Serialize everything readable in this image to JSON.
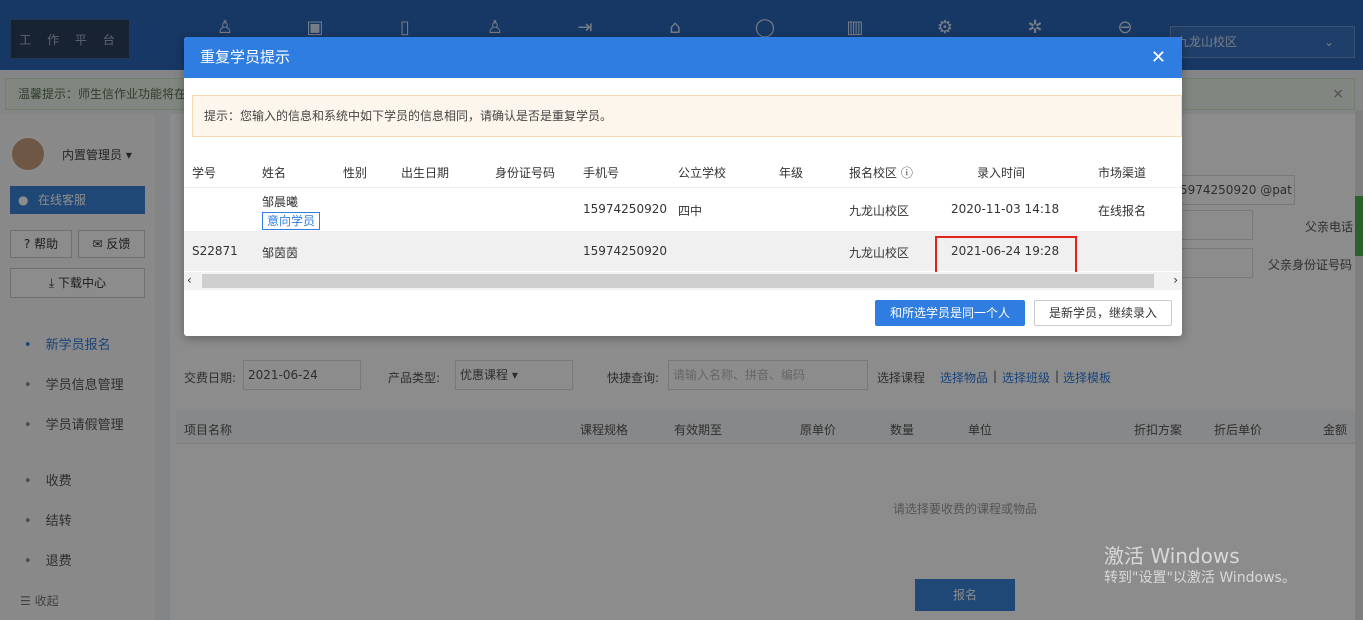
{
  "topbar": {
    "logo_text": "工 作 平 台",
    "nav_icons": [
      "user-add-icon",
      "card-icon",
      "book-icon",
      "person-icon",
      "login-icon",
      "home-icon",
      "refresh-icon",
      "chart-icon",
      "gear-icon",
      "tool-icon",
      "more-icon"
    ],
    "campus": "九龙山校区"
  },
  "notice": {
    "text": "温馨提示：师生信作业功能将在"
  },
  "sidebar": {
    "admin_name": "内置管理员",
    "service_label": "在线客服",
    "help_label": "帮助",
    "feedback_label": "反馈",
    "download_label": "下载中心",
    "menu": [
      {
        "label": "新学员报名",
        "active": true
      },
      {
        "label": "学员信息管理",
        "active": false
      },
      {
        "label": "学员请假管理",
        "active": false
      },
      {
        "label": "收费",
        "active": false
      },
      {
        "label": "结转",
        "active": false
      },
      {
        "label": "退费",
        "active": false
      }
    ],
    "collapse_label": "收起"
  },
  "main": {
    "phone_partial": "5974250920",
    "email_suffix": "@pat",
    "father_phone_label": "父亲电话",
    "father_id_label": "父亲身份证号码",
    "fee_date_label": "交费日期:",
    "fee_date_value": "2021-06-24",
    "product_type_label": "产品类型:",
    "product_type_value": "优惠课程",
    "quick_query_label": "快捷查询:",
    "quick_query_placeholder": "请输入名称、拼音、编码",
    "select_course": "选择课程",
    "select_goods": "选择物品",
    "select_class": "选择班级",
    "select_template": "选择模板",
    "table_headers": [
      "项目名称",
      "课程规格",
      "有效期至",
      "原单价",
      "数量",
      "单位",
      "折扣方案",
      "折后单价",
      "金额"
    ],
    "empty_text": "请选择要收费的课程或物品",
    "submit_label": "报名"
  },
  "modal": {
    "title": "重复学员提示",
    "alert": "提示：您输入的信息和系统中如下学员的信息相同，请确认是否是重复学员。",
    "columns": [
      "学号",
      "姓名",
      "性别",
      "出生日期",
      "身份证号码",
      "手机号",
      "公立学校",
      "年级",
      "报名校区",
      "录入时间",
      "市场渠道"
    ],
    "rows": [
      {
        "student_no": "",
        "name": "邹晨曦",
        "tag": "意向学员",
        "gender": "",
        "birth": "",
        "id_no": "",
        "phone": "15974250920",
        "school": "四中",
        "grade": "",
        "campus": "九龙山校区",
        "time": "2020-11-03 14:18",
        "channel": "在线报名"
      },
      {
        "student_no": "S22871",
        "name": "邹茵茵",
        "tag": "",
        "gender": "",
        "birth": "",
        "id_no": "",
        "phone": "15974250920",
        "school": "",
        "grade": "",
        "campus": "九龙山校区",
        "time": "2021-06-24 19:28",
        "channel": ""
      }
    ],
    "btn_same": "和所选学员是同一个人",
    "btn_new": "是新学员，继续录入"
  },
  "watermark": {
    "line1": "激活 Windows",
    "line2": "转到\"设置\"以激活 Windows。"
  },
  "colors": {
    "primary": "#2f7de1",
    "highlight_box": "#e2231a"
  }
}
